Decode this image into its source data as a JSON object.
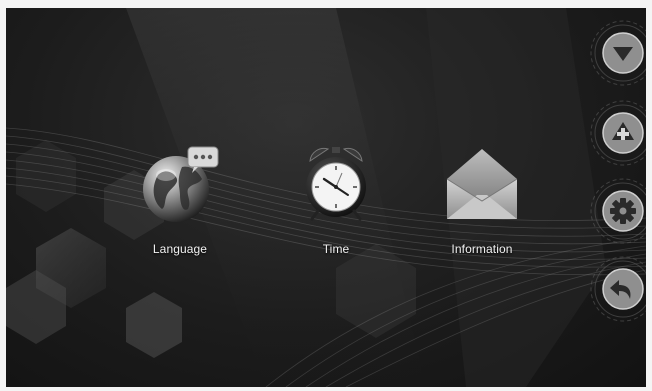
{
  "menu": {
    "items": [
      {
        "label": "Language",
        "icon": "globe-chat-icon"
      },
      {
        "label": "Time",
        "icon": "alarm-clock-icon"
      },
      {
        "label": "Information",
        "icon": "envelope-icon"
      }
    ]
  },
  "side_buttons": [
    {
      "icon": "triangle-down-icon"
    },
    {
      "icon": "plus-icon"
    },
    {
      "icon": "gear-icon"
    },
    {
      "icon": "back-arrow-icon"
    }
  ],
  "colors": {
    "background": "#1c1c1c",
    "label": "#f2f2f2",
    "button_fill": "#9a9a9a"
  }
}
